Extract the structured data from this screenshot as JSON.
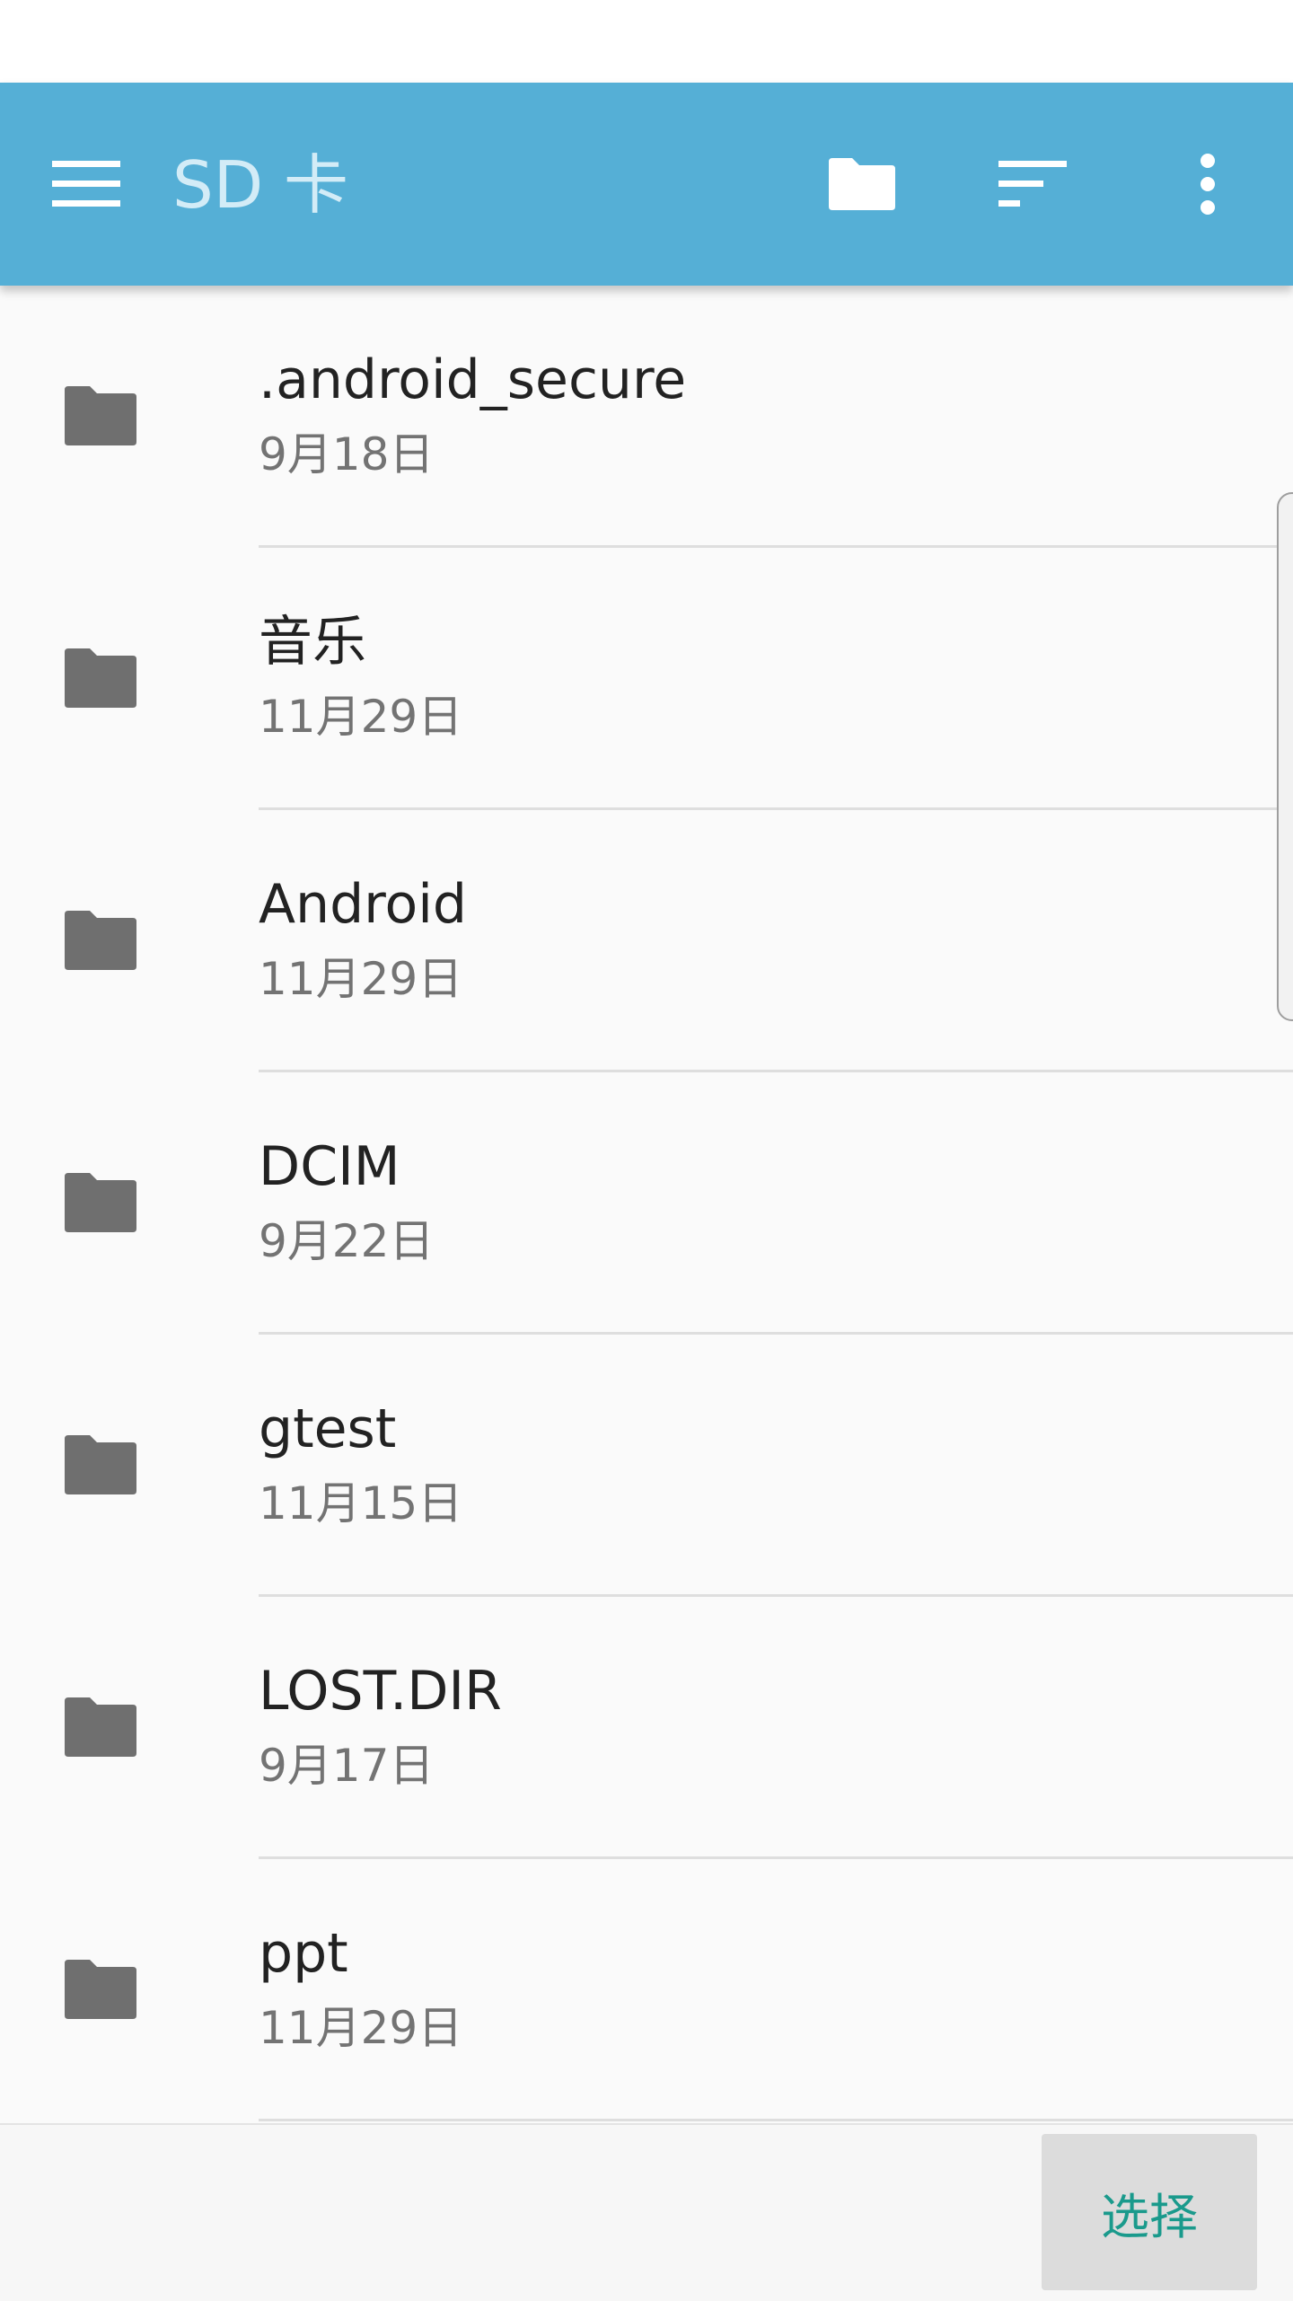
{
  "toolbar": {
    "title": "SD 卡",
    "background_color": "#55afd6",
    "icons": [
      "menu-icon",
      "new-folder-icon",
      "sort-icon",
      "more-vert-icon"
    ]
  },
  "files": [
    {
      "name": ".android_secure",
      "date": "9月18日",
      "icon": "folder-icon"
    },
    {
      "name": "音乐",
      "date": "11月29日",
      "icon": "folder-icon"
    },
    {
      "name": "Android",
      "date": "11月29日",
      "icon": "folder-icon"
    },
    {
      "name": "DCIM",
      "date": "9月22日",
      "icon": "folder-icon"
    },
    {
      "name": "gtest",
      "date": "11月15日",
      "icon": "folder-icon"
    },
    {
      "name": "LOST.DIR",
      "date": "9月17日",
      "icon": "folder-icon"
    },
    {
      "name": "ppt",
      "date": "11月29日",
      "icon": "folder-icon"
    }
  ],
  "footer": {
    "select_label": "选择",
    "accent_color": "#1a9a8c"
  }
}
